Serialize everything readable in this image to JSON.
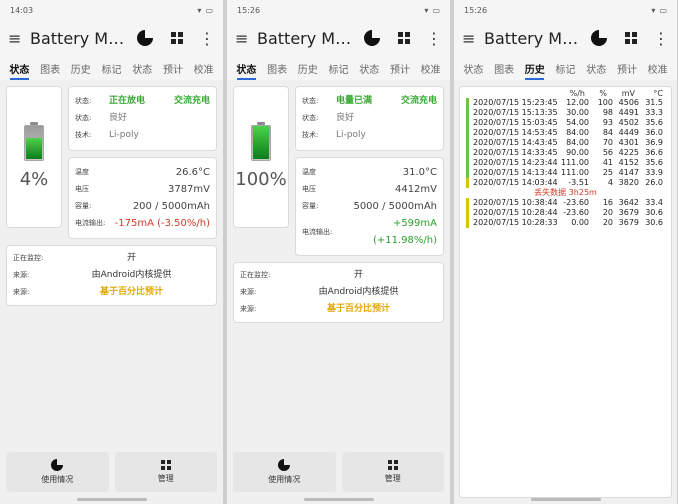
{
  "common": {
    "app_title": "Battery Mon⋯",
    "tabs": [
      "状态",
      "图表",
      "历史",
      "标记",
      "状态",
      "预计",
      "校准"
    ],
    "btn_usage": "使用情况",
    "btn_manage": "管理"
  },
  "screen1": {
    "time": "14:03",
    "battery_pct": "4%",
    "status_label": "状态:",
    "status_value": "正在放电",
    "status_right": "交流充电",
    "health_label": "状态:",
    "health_value": "良好",
    "tech_label": "技术:",
    "tech_value": "Li-poly",
    "temp_label": "温度",
    "temp_value": "26.6°C",
    "voltage_label": "电压",
    "voltage_value": "3787mV",
    "capacity_label": "容量:",
    "capacity_value": "200 / 5000mAh",
    "current_label": "电流输出:",
    "current_value": "-175mA (-3.50%/h)",
    "monitor_label": "正在监控:",
    "monitor_value": "开",
    "source_label": "来源:",
    "source_value": "由Android内核提供",
    "source2_label": "来源:",
    "source2_value": "基于百分比预计"
  },
  "screen2": {
    "time": "15:26",
    "battery_pct": "100%",
    "status_label": "状态:",
    "status_value": "电量已满",
    "status_right": "交流充电",
    "health_label": "状态:",
    "health_value": "良好",
    "tech_label": "技术:",
    "tech_value": "Li-poly",
    "temp_label": "温度",
    "temp_value": "31.0°C",
    "voltage_label": "电压",
    "voltage_value": "4412mV",
    "capacity_label": "容量:",
    "capacity_value": "5000 / 5000mAh",
    "current_label": "电流输出:",
    "current_value": "+599mA (+11.98%/h)",
    "monitor_label": "正在监控:",
    "monitor_value": "开",
    "source_label": "来源:",
    "source_value": "由Android内核提供",
    "source2_label": "来源:",
    "source2_value": "基于百分比预计"
  },
  "screen3": {
    "time": "15:26",
    "headers": [
      "%/h",
      "%",
      "mV",
      "°C"
    ],
    "rows_before": [
      [
        "2020/07/15 15:23:45",
        "12.00",
        "100",
        "4506",
        "31.5"
      ],
      [
        "2020/07/15 15:13:35",
        "30.00",
        "98",
        "4491",
        "33.3"
      ],
      [
        "2020/07/15 15:03:45",
        "54.00",
        "93",
        "4502",
        "35.6"
      ],
      [
        "2020/07/15 14:53:45",
        "84.00",
        "84",
        "4449",
        "36.0"
      ],
      [
        "2020/07/15 14:43:45",
        "84.00",
        "70",
        "4301",
        "36.9"
      ],
      [
        "2020/07/15 14:33:45",
        "90.00",
        "56",
        "4225",
        "36.6"
      ],
      [
        "2020/07/15 14:23:44",
        "111.00",
        "41",
        "4152",
        "35.6"
      ],
      [
        "2020/07/15 14:13:44",
        "111.00",
        "25",
        "4147",
        "33.9"
      ],
      [
        "2020/07/15 14:03:44",
        "-3.51",
        "4",
        "3820",
        "26.0"
      ]
    ],
    "lost_text": "丢失数据 3h25m",
    "rows_after": [
      [
        "2020/07/15 10:38:44",
        "-23.60",
        "16",
        "3642",
        "33.4"
      ],
      [
        "2020/07/15 10:28:44",
        "-23.60",
        "20",
        "3679",
        "30.6"
      ],
      [
        "2020/07/15 10:28:33",
        "0.00",
        "20",
        "3679",
        "30.6"
      ]
    ]
  }
}
